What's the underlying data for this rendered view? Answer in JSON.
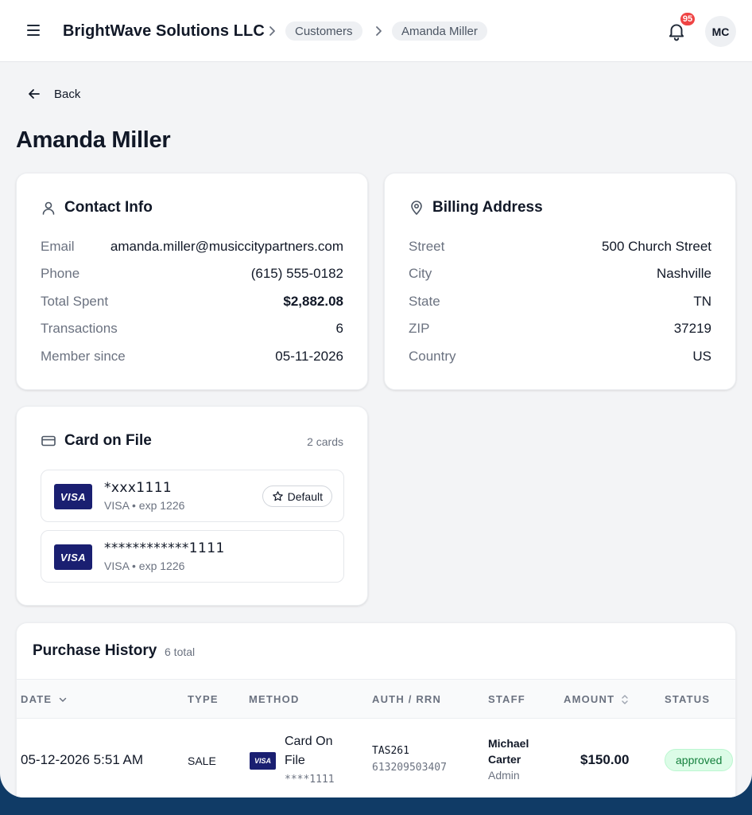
{
  "header": {
    "company": "BrightWave Solutions LLC",
    "breadcrumbs": [
      "Customers",
      "Amanda Miller"
    ],
    "notification_count": "95",
    "avatar_initials": "MC"
  },
  "nav": {
    "back_label": "Back"
  },
  "page": {
    "title": "Amanda Miller"
  },
  "contact": {
    "title": "Contact Info",
    "rows": [
      {
        "label": "Email",
        "value": "amanda.miller@musiccitypartners.com"
      },
      {
        "label": "Phone",
        "value": "(615) 555-0182"
      },
      {
        "label": "Total Spent",
        "value": "$2,882.08"
      },
      {
        "label": "Transactions",
        "value": "6"
      },
      {
        "label": "Member since",
        "value": "05-11-2026"
      }
    ]
  },
  "billing": {
    "title": "Billing Address",
    "rows": [
      {
        "label": "Street",
        "value": "500 Church Street"
      },
      {
        "label": "City",
        "value": "Nashville"
      },
      {
        "label": "State",
        "value": "TN"
      },
      {
        "label": "ZIP",
        "value": "37219"
      },
      {
        "label": "Country",
        "value": "US"
      }
    ]
  },
  "cards": {
    "title": "Card on File",
    "count_label": "2 cards",
    "items": [
      {
        "brand": "VISA",
        "number": "*xxx1111",
        "sub": "VISA • exp 1226",
        "default_label": "Default"
      },
      {
        "brand": "VISA",
        "number": "************1111",
        "sub": "VISA • exp 1226"
      }
    ]
  },
  "history": {
    "title": "Purchase History",
    "total_label": "6 total",
    "columns": [
      "DATE",
      "TYPE",
      "METHOD",
      "AUTH / RRN",
      "STAFF",
      "AMOUNT",
      "STATUS"
    ],
    "rows": [
      {
        "date": "05-12-2026 5:51 AM",
        "type": "SALE",
        "method_brand": "VISA",
        "method_line1": "Card On",
        "method_line2": "File",
        "method_card": "****1111",
        "auth": "TAS261",
        "rrn": "613209503407",
        "staff_first": "Michael",
        "staff_last": "Carter",
        "staff_role": "Admin",
        "amount": "$150.00",
        "status": "approved"
      }
    ]
  },
  "colors": {
    "visa": "#1a1f71",
    "badge": "#ef4444",
    "approved_bg": "#dcfce7",
    "approved_text": "#15803d",
    "frame": "#103b66"
  }
}
